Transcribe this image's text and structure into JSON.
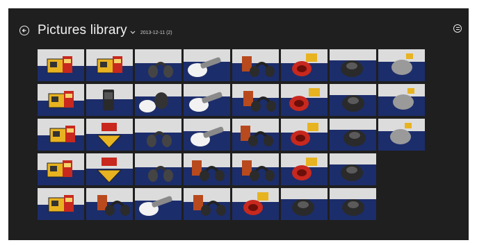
{
  "header": {
    "title": "Pictures library",
    "subtitle": "2013-12-11 (2)",
    "back_icon": "back-arrow-icon",
    "dropdown_icon": "chevron-down-icon",
    "select_icon": "select-mode-icon"
  },
  "gallery": {
    "rows": [
      [
        "toy-bulldozer-box",
        "toy-bulldozer-box",
        "headphones-stand",
        "gloved-hand-tool",
        "headphones-box",
        "red-headphones",
        "black-mouse",
        "silver-mouse"
      ],
      [
        "toy-bulldozer-box",
        "phone-case-box",
        "gloved-hand-headphones",
        "gloved-hand-tool",
        "headphones-box",
        "red-headphones",
        "black-mouse",
        "silver-mouse"
      ],
      [
        "toy-bulldozer-box",
        "toy-yellow-truck",
        "headphones-stand",
        "gloved-hand-tool",
        "headphones-box",
        "red-headphones",
        "black-mouse",
        "silver-mouse"
      ],
      [
        "toy-bulldozer-box",
        "toy-yellow-truck",
        "headphones-stand",
        "headphones-box",
        "headphones-box",
        "red-headphones",
        "black-mouse"
      ],
      [
        "toy-bulldozer-box",
        "headphones-box",
        "gloved-hand-tool",
        "headphones-box",
        "red-headphones",
        "black-mouse",
        "black-mouse"
      ]
    ]
  },
  "colors": {
    "background": "#1f1f1f",
    "photo_backdrop": "#1c2d6b",
    "photo_wall": "#dcdcdc",
    "toy_yellow": "#e8b320",
    "toy_red": "#c8281e"
  }
}
